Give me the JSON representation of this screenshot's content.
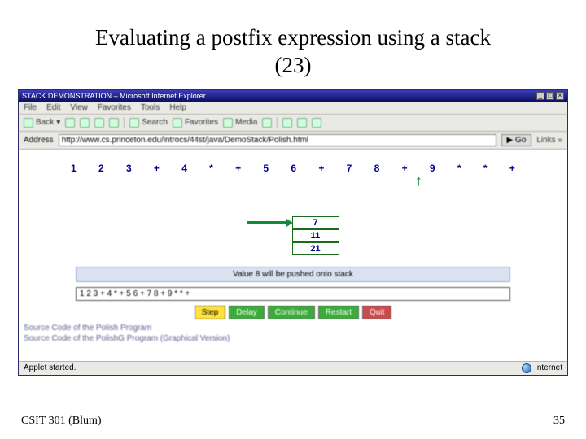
{
  "slide": {
    "title_line1": "Evaluating a postfix expression using a stack",
    "title_line2": "(23)",
    "footer_left": "CSIT 301 (Blum)",
    "footer_right": "35"
  },
  "browser": {
    "titlebar": "STACK DEMONSTRATION – Microsoft Internet Explorer",
    "menus": [
      "File",
      "Edit",
      "View",
      "Favorites",
      "Tools",
      "Help"
    ],
    "toolbar": {
      "back": "Back",
      "search": "Search",
      "favorites": "Favorites",
      "media": "Media"
    },
    "address_label": "Address",
    "address_value": "http://www.cs.princeton.edu/introcs/44st/java/DemoStack/Polish.html",
    "go": "Go",
    "links": "Links »"
  },
  "applet": {
    "tokens": [
      "1",
      "2",
      "3",
      "+",
      "4",
      "*",
      "+",
      "5",
      "6",
      "+",
      "7",
      "8",
      "+",
      "9",
      "*",
      "*",
      "+"
    ],
    "stack": [
      "7",
      "11",
      "21"
    ],
    "status": "Value 8 will be pushed onto stack",
    "input_value": "1 2 3 + 4 * + 5 6 + 7 8 + 9 * * +",
    "buttons": {
      "step": "Step",
      "delay": "Delay",
      "continue": "Continue",
      "restart": "Restart",
      "quit": "Quit"
    },
    "source1": "Source Code of the Polish Program",
    "source2": "Source Code of the PolishG Program (Graphical Version)"
  },
  "statusbar": {
    "left": "Applet started.",
    "right": "Internet"
  }
}
